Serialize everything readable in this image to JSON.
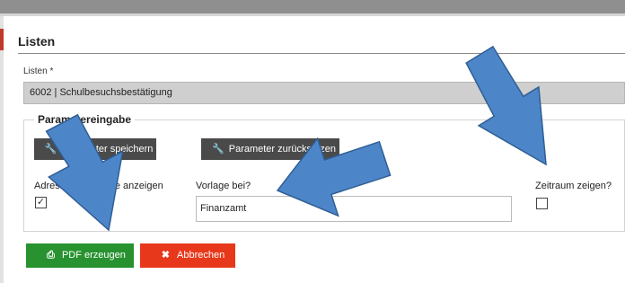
{
  "panel": {
    "title": "Listen"
  },
  "list_field": {
    "label": "Listen *",
    "value": "6002 | Schulbesuchsbestätigung"
  },
  "parameter_group": {
    "legend": "Parametereingabe",
    "save_button": "Parameter speichern",
    "reset_button": "Parameter zurücksetzen"
  },
  "options": {
    "address_label": "Adresse der Schule anzeigen",
    "address_checked": true,
    "template_label": "Vorlage bei?",
    "template_value": "Finanzamt",
    "period_label": "Zeitraum zeigen?",
    "period_checked": false
  },
  "actions": {
    "pdf_button": "PDF erzeugen",
    "cancel_button": "Abbrechen"
  },
  "icons": {
    "save": "wrench-icon",
    "reset": "wrench-icon",
    "pdf": "printer-icon",
    "cancel": "close-icon",
    "checkmark": "checkmark-icon"
  },
  "colors": {
    "pdf_button": "#27922f",
    "cancel_button": "#e8381b",
    "dark_button": "#4a4a4a",
    "select_background": "#cfcfcf",
    "annotation_arrow": "#4d86c8"
  }
}
